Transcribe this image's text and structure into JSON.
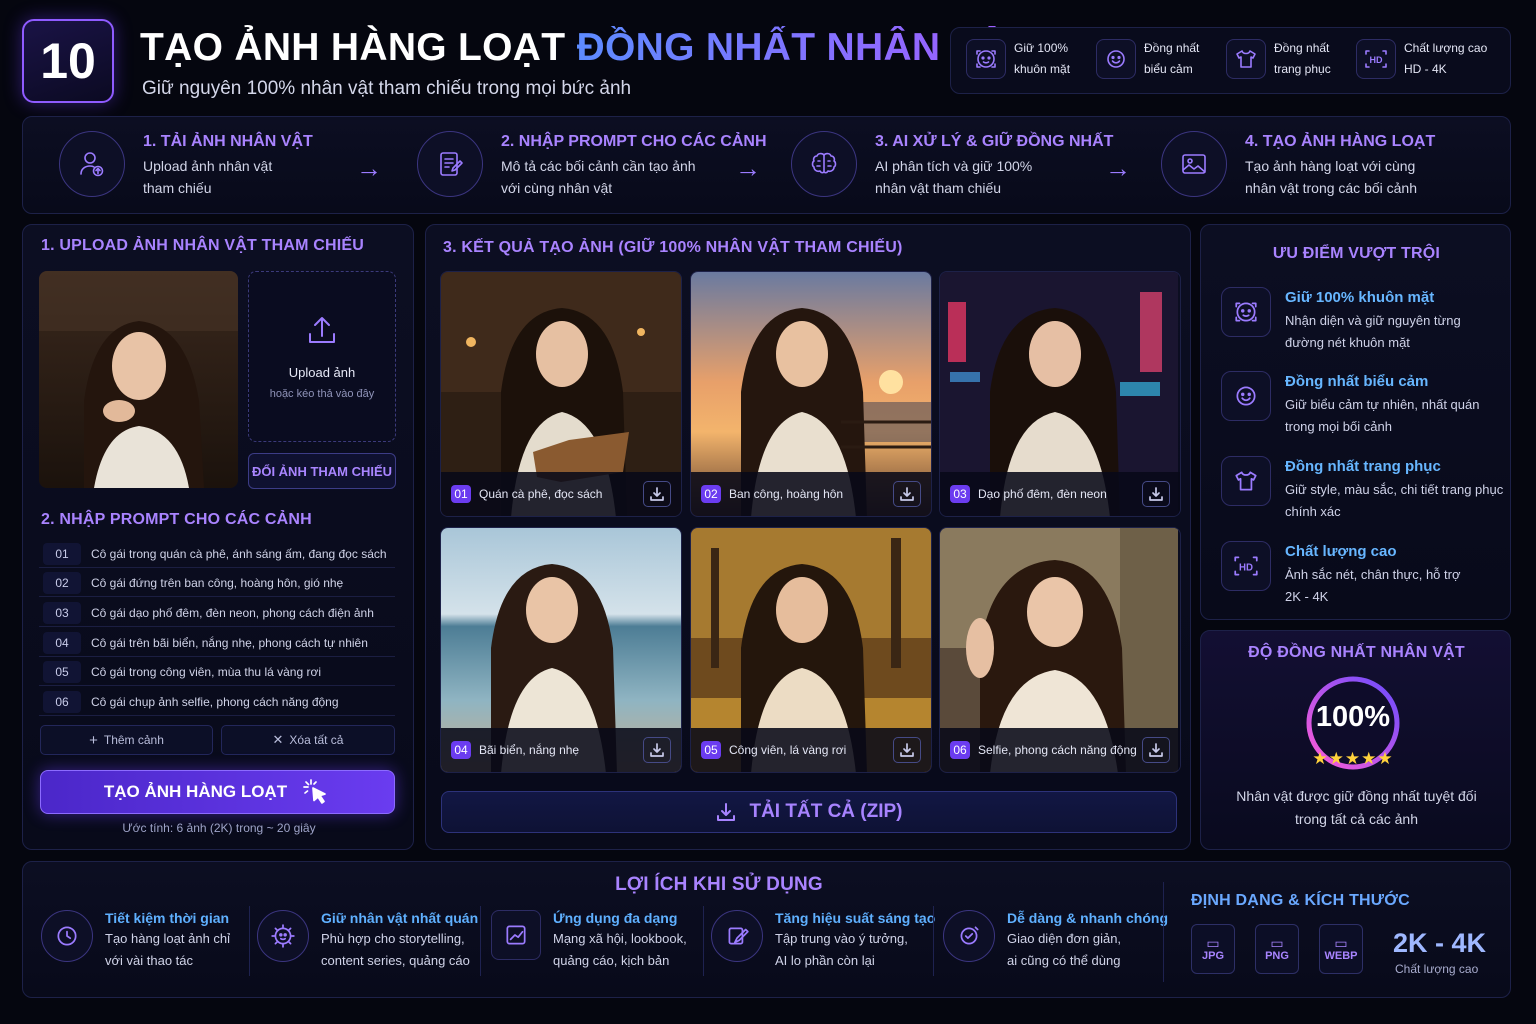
{
  "header": {
    "number": "10",
    "title_part1": "TẠO ẢNH HÀNG LOẠT",
    "title_part2": "ĐỒNG NHẤT NHÂN VẬT",
    "subtitle": "Giữ nguyên 100% nhân vật tham chiếu trong mọi bức ảnh",
    "features": [
      {
        "icon": "face-icon",
        "line1": "Giữ 100%",
        "line2": "khuôn mặt"
      },
      {
        "icon": "smile-icon",
        "line1": "Đồng nhất",
        "line2": "biểu cảm"
      },
      {
        "icon": "shirt-icon",
        "line1": "Đồng nhất",
        "line2": "trang phục"
      },
      {
        "icon": "hd-icon",
        "line1": "Chất lượng cao",
        "line2": "HD - 4K"
      }
    ]
  },
  "steps": [
    {
      "icon": "user-upload-icon",
      "title": "1. TẢI ẢNH NHÂN VẬT",
      "line1": "Upload ảnh nhân vật",
      "line2": "tham chiếu"
    },
    {
      "icon": "edit-document-icon",
      "title": "2. NHẬP PROMPT CHO CÁC CẢNH",
      "line1": "Mô tả các bối cảnh cần tạo ảnh",
      "line2": "với cùng nhân vật"
    },
    {
      "icon": "brain-icon",
      "title": "3. AI XỬ LÝ & GIỮ ĐỒNG NHẤT",
      "line1": "AI phân tích và giữ 100%",
      "line2": "nhân vật tham chiếu"
    },
    {
      "icon": "image-icon",
      "title": "4. TẠO ẢNH HÀNG LOẠT",
      "line1": "Tạo ảnh hàng loạt với cùng",
      "line2": "nhân vật trong các bối cảnh"
    }
  ],
  "upload": {
    "section_title": "1. UPLOAD ẢNH NHÂN VẬT THAM CHIẾU",
    "upload_label": "Upload ảnh",
    "upload_hint": "hoặc kéo thả vào đây",
    "swap_button": "ĐỔI ẢNH THAM CHIẾU"
  },
  "prompts": {
    "section_title": "2. NHẬP PROMPT CHO CÁC CẢNH",
    "items": [
      {
        "num": "01",
        "text": "Cô gái trong quán cà phê, ánh sáng ấm, đang đọc sách"
      },
      {
        "num": "02",
        "text": "Cô gái đứng trên ban công, hoàng hôn, gió nhẹ"
      },
      {
        "num": "03",
        "text": "Cô gái dạo phố đêm, đèn neon, phong cách điện ảnh"
      },
      {
        "num": "04",
        "text": "Cô gái trên bãi biển, nắng nhẹ, phong cách tự nhiên"
      },
      {
        "num": "05",
        "text": "Cô gái trong công viên, mùa thu lá vàng rơi"
      },
      {
        "num": "06",
        "text": "Cô gái chụp ảnh selfie, phong cách năng động"
      }
    ],
    "add_button": "Thêm cảnh",
    "clear_button": "Xóa tất cả",
    "generate_button": "TẠO ẢNH HÀNG LOẠT",
    "estimate": "Ước tính: 6 ảnh (2K) trong ~ 20 giây"
  },
  "results": {
    "section_title": "3. KẾT QUẢ TẠO ẢNH (GIỮ 100% NHÂN VẬT THAM CHIẾU)",
    "items": [
      {
        "num": "01",
        "caption": "Quán cà phê, đọc sách"
      },
      {
        "num": "02",
        "caption": "Ban công, hoàng hôn"
      },
      {
        "num": "03",
        "caption": "Dạo phố đêm, đèn neon"
      },
      {
        "num": "04",
        "caption": "Bãi biển, nắng nhẹ"
      },
      {
        "num": "05",
        "caption": "Công viên, lá vàng rơi"
      },
      {
        "num": "06",
        "caption": "Selfie, phong cách năng động"
      }
    ],
    "download_all": "TẢI TẤT CẢ (ZIP)"
  },
  "advantages": {
    "title": "ƯU ĐIỂM VƯỢT TRỘI",
    "items": [
      {
        "icon": "face-icon",
        "title": "Giữ 100% khuôn mặt",
        "line1": "Nhận diện và giữ nguyên từng",
        "line2": "đường nét khuôn mặt"
      },
      {
        "icon": "smile-icon",
        "title": "Đồng nhất biểu cảm",
        "line1": "Giữ biểu cảm tự nhiên, nhất quán",
        "line2": "trong mọi bối cảnh"
      },
      {
        "icon": "shirt-icon",
        "title": "Đồng nhất trang phục",
        "line1": "Giữ style, màu sắc, chi tiết trang phục",
        "line2": "chính xác"
      },
      {
        "icon": "hd-icon",
        "title": "Chất lượng cao",
        "line1": "Ảnh sắc nét, chân thực, hỗ trợ",
        "line2": "2K - 4K"
      }
    ]
  },
  "consistency": {
    "title": "ĐỘ ĐỒNG NHẤT NHÂN VẬT",
    "percent_label": "100%",
    "percent": 100,
    "rating": 5,
    "line1": "Nhân vật được giữ đồng nhất tuyệt đối",
    "line2": "trong tất cả các ảnh"
  },
  "benefits": {
    "title": "LỢI ÍCH KHI SỬ DỤNG",
    "items": [
      {
        "icon": "clock-icon",
        "title": "Tiết kiệm thời gian",
        "line1": "Tạo hàng loạt ảnh chỉ",
        "line2": "với vài thao tác"
      },
      {
        "icon": "user-gear-icon",
        "title": "Giữ nhân vật nhất quán",
        "line1": "Phù hợp cho storytelling,",
        "line2": "content series, quảng cáo"
      },
      {
        "icon": "chart-icon",
        "title": "Ứng dụng đa dạng",
        "line1": "Mạng xã hội, lookbook,",
        "line2": "quảng cáo, kịch bản"
      },
      {
        "icon": "pen-icon",
        "title": "Tăng hiệu suất sáng tạo",
        "line1": "Tập trung vào ý tưởng,",
        "line2": "AI lo phần còn lại"
      },
      {
        "icon": "check-badge-icon",
        "title": "Dễ dàng & nhanh chóng",
        "line1": "Giao diện đơn giản,",
        "line2": "ai cũng có thể dùng"
      }
    ]
  },
  "formats": {
    "title": "ĐỊNH DẠNG & KÍCH THƯỚC",
    "types": [
      "JPG",
      "PNG",
      "WEBP"
    ],
    "size": "2K - 4K",
    "size_caption": "Chất lượng cao"
  },
  "colors": {
    "accent": "#8f5bff",
    "heading": "#a983ff",
    "highlight": "#5fb0ff",
    "star": "#ffd23c"
  }
}
